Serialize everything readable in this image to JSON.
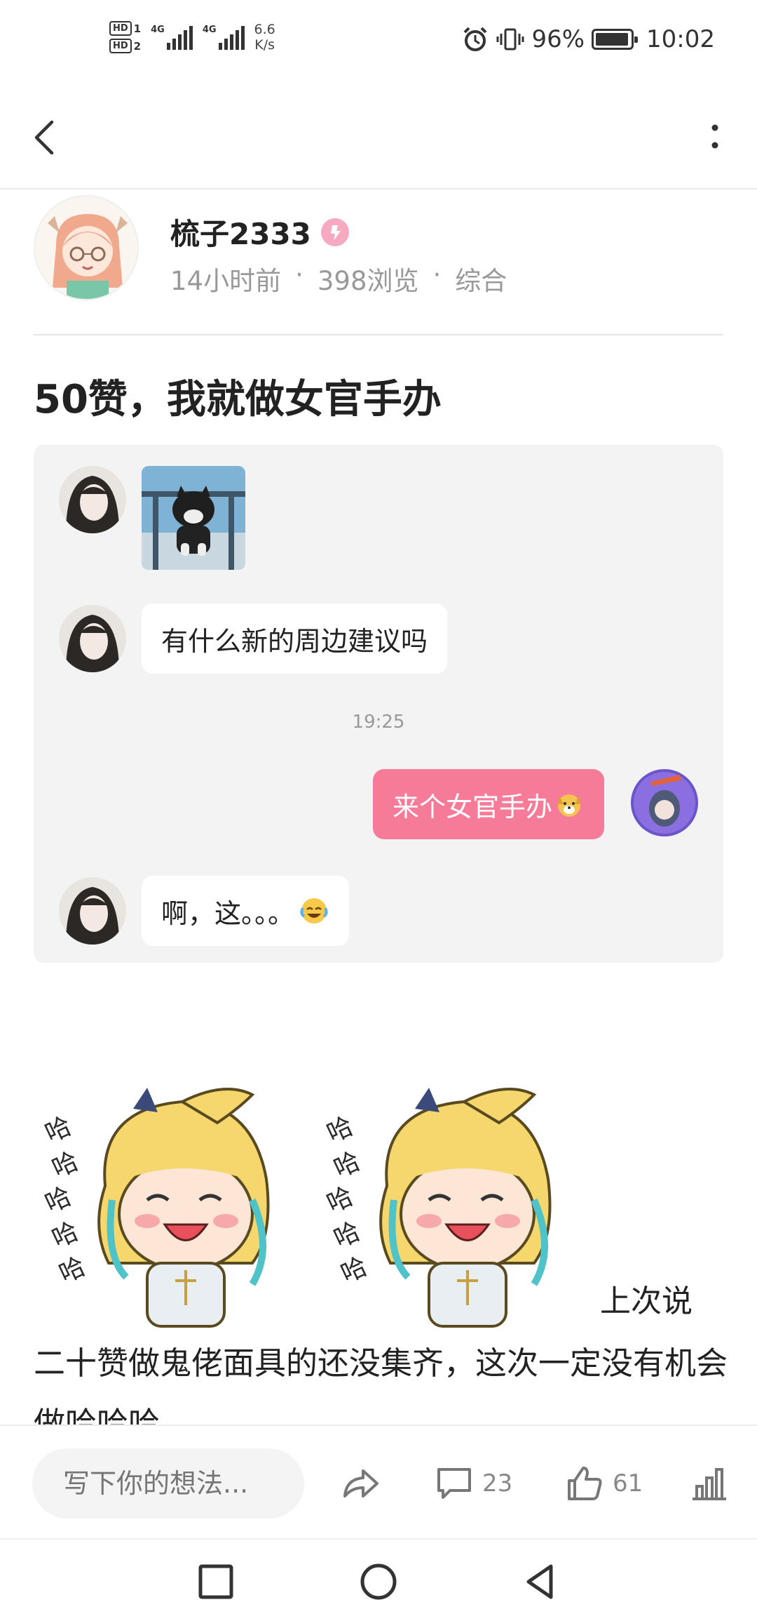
{
  "status_bar": {
    "hd1": "HD",
    "hd1_num": "1",
    "hd2": "HD",
    "hd2_num": "2",
    "net1": "4G",
    "net2": "4G",
    "speed_value": "6.6",
    "speed_unit": "K/s",
    "battery": "96%",
    "battery_level": 0.96,
    "time": "10:02",
    "icons": [
      "alarm-icon",
      "vibrate-icon",
      "battery-icon"
    ]
  },
  "nav": {
    "back_icon": "chevron-left-icon",
    "more_icon": "more-vertical-icon"
  },
  "author": {
    "name": "梳子2333",
    "badge_icon": "user-level-badge-icon",
    "time_ago": "14小时前",
    "separator": "·",
    "views": "398浏览",
    "category": "综合"
  },
  "post": {
    "title": "50赞，我就做女官手办",
    "chat": {
      "messages": [
        {
          "side": "left",
          "type": "image",
          "alt": "dog sticker"
        },
        {
          "side": "left",
          "type": "text",
          "text": "有什么新的周边建议吗"
        },
        {
          "side": "right",
          "type": "text",
          "text": "来个女官手办",
          "emoji": "dog-face-emoji"
        },
        {
          "side": "left",
          "type": "text",
          "text": "啊，这。。。",
          "emoji": "laughing-tears-emoji"
        }
      ],
      "time": "19:25"
    },
    "inline_text": "上次说",
    "paragraph": "二十赞做鬼佬面具的还没集齐，这次一定没有机会做哈哈哈"
  },
  "action_bar": {
    "input_placeholder": "写下你的想法...",
    "share_icon": "share-icon",
    "comment_icon": "comment-icon",
    "comment_count": "23",
    "like_icon": "thumbs-up-icon",
    "like_count": "61",
    "stats_icon": "bar-chart-icon"
  },
  "system_nav": {
    "recent_icon": "square-recent-apps-icon",
    "home_icon": "circle-home-icon",
    "back_icon": "triangle-back-icon"
  },
  "colors": {
    "accent_pink": "#f67b98",
    "chat_bg": "#f3f3f3",
    "meta_gray": "#999999"
  }
}
